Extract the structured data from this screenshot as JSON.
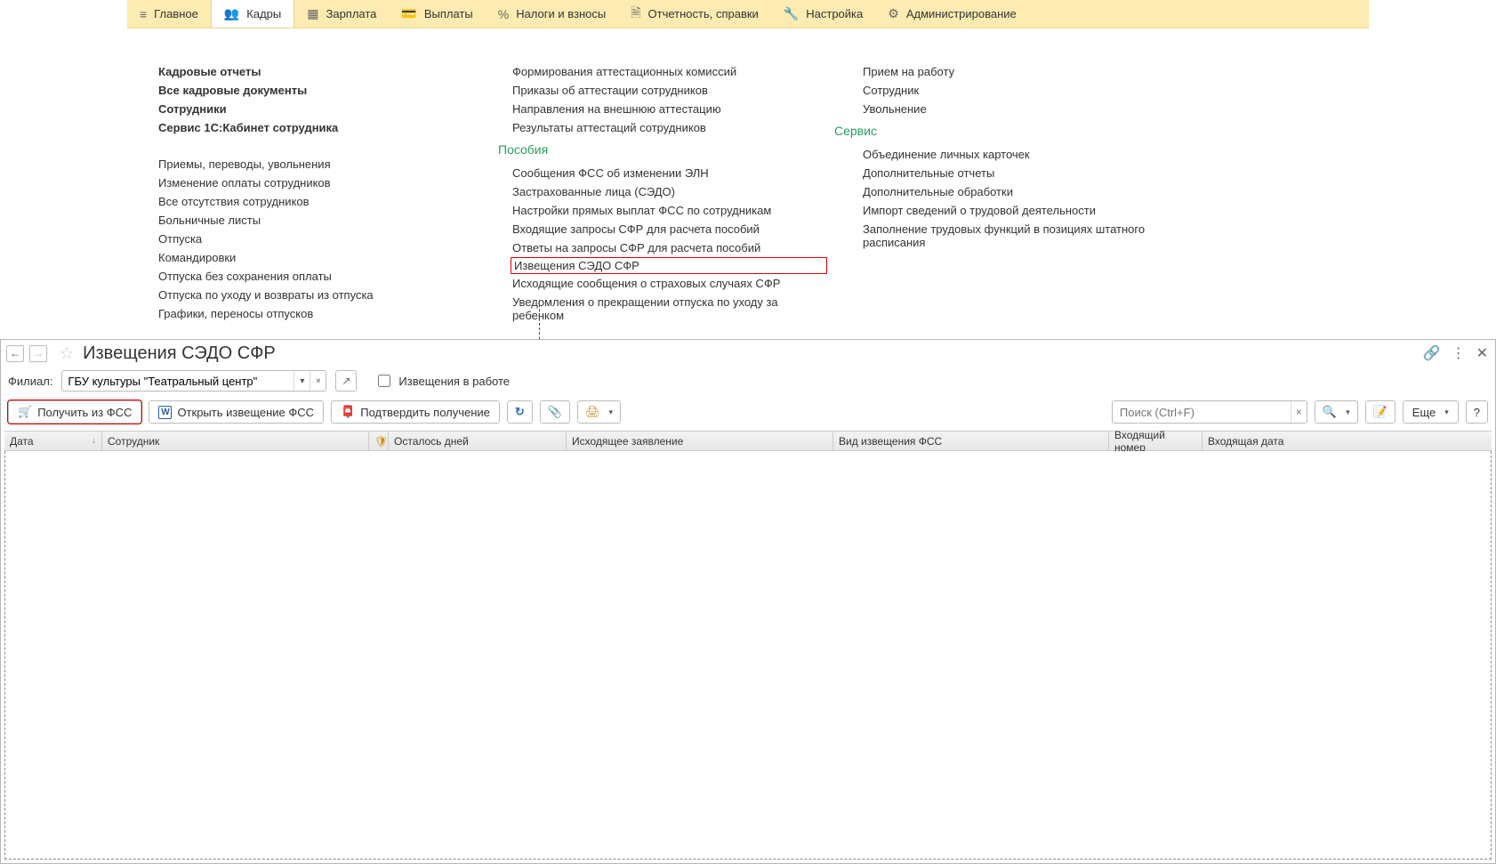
{
  "topnav": {
    "items": [
      {
        "label": "Главное"
      },
      {
        "label": "Кадры"
      },
      {
        "label": "Зарплата"
      },
      {
        "label": "Выплаты"
      },
      {
        "label": "Налоги и взносы"
      },
      {
        "label": "Отчетность, справки"
      },
      {
        "label": "Настройка"
      },
      {
        "label": "Администрирование"
      }
    ]
  },
  "panel": {
    "col1_heads": [
      "Кадровые отчеты",
      "Все кадровые документы",
      "Сотрудники",
      "Сервис 1С:Кабинет сотрудника"
    ],
    "col1_links": [
      "Приемы, переводы, увольнения",
      "Изменение оплаты сотрудников",
      "Все отсутствия сотрудников",
      "Больничные листы",
      "Отпуска",
      "Командировки",
      "Отпуска без сохранения оплаты",
      "Отпуска по уходу и возвраты из отпуска",
      "Графики, переносы отпусков"
    ],
    "col2_plain": [
      "Формирования аттестационных комиссий",
      "Приказы об аттестации сотрудников",
      "Направления на внешнюю аттестацию",
      "Результаты аттестаций сотрудников"
    ],
    "col2_section": "Пособия",
    "col2_links": [
      "Сообщения ФСС об изменении ЭЛН",
      "Застрахованные лица (СЭДО)",
      "Настройки прямых выплат ФСС по сотрудникам",
      "Входящие запросы СФР для расчета пособий",
      "Ответы на запросы СФР для расчета пособий",
      "Извещения СЭДО СФР",
      "Исходящие сообщения о страховых случаях СФР",
      "Уведомления о прекращении отпуска по уходу за ребенком"
    ],
    "col3_plain": [
      "Прием на работу",
      "Сотрудник",
      "Увольнение"
    ],
    "col3_section": "Сервис",
    "col3_links": [
      "Объединение личных карточек",
      "Дополнительные отчеты",
      "Дополнительные обработки",
      "Импорт сведений о трудовой деятельности",
      "Заполнение трудовых функций в позициях штатного расписания"
    ]
  },
  "window": {
    "title": "Извещения СЭДО СФР",
    "filter_label": "Филиал:",
    "filter_value": "ГБУ культуры \"Театральный центр\"",
    "checkbox_label": "Извещения в работе",
    "toolbar": {
      "get_fss": "Получить из ФСС",
      "open_fss": "Открыть извещение ФСС",
      "confirm": "Подтвердить получение",
      "more": "Еще"
    },
    "search_placeholder": "Поиск (Ctrl+F)",
    "columns": [
      "Дата",
      "Сотрудник",
      "Осталось дней",
      "Исходящее заявление",
      "Вид извещения ФСС",
      "Входящий номер",
      "Входящая дата"
    ]
  }
}
